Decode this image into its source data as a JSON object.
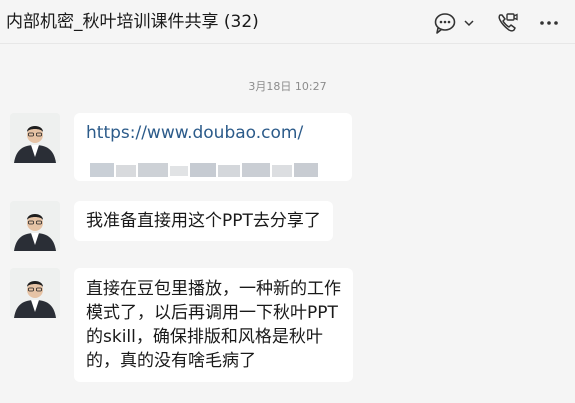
{
  "header": {
    "title": "内部机密_秋叶培训课件共享 (32)",
    "icons": [
      "chat-bubble-icon",
      "chevron-down-icon",
      "phone-video-icon",
      "more-icon"
    ]
  },
  "timestamp": "3月18日 10:27",
  "messages": [
    {
      "type": "link",
      "avatar_badge": "5",
      "lines": [
        "https://www.doubao.com/"
      ],
      "has_blurred_preview": true
    },
    {
      "type": "text",
      "avatar_badge": "5",
      "lines": [
        "我准备直接用这个PPT去分享了"
      ]
    },
    {
      "type": "text",
      "avatar_badge": "5",
      "lines": [
        "直接在豆包里播放，一种新的工作",
        "模式了，以后再调用一下秋叶PPT",
        "的skill，确保排版和风格是秋叶",
        "的，真的没有啥毛病了"
      ]
    }
  ],
  "colors": {
    "background": "#f5f5f5",
    "bubble": "#ffffff",
    "link": "#2c5b8a",
    "text": "#191919",
    "timestamp": "#8c8c8c"
  }
}
